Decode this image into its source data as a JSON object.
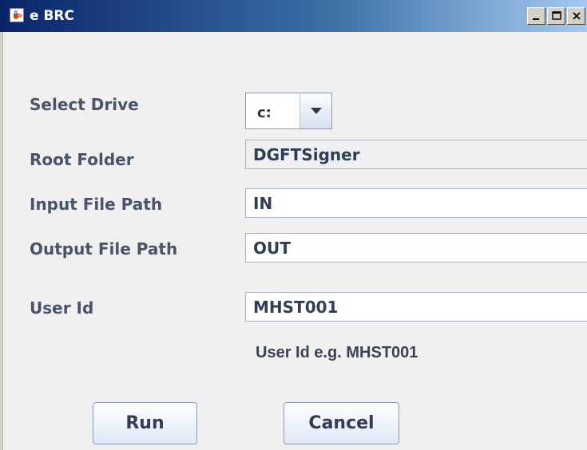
{
  "window": {
    "title": "e BRC",
    "controls": [
      "minimize",
      "maximize",
      "close"
    ]
  },
  "form": {
    "select_drive_label": "Select Drive",
    "select_drive_value": "c:",
    "root_folder_label": "Root Folder",
    "root_folder_value": "DGFTSigner",
    "input_file_path_label": "Input File Path",
    "input_file_path_value": "IN",
    "output_file_path_label": "Output File Path",
    "output_file_path_value": "OUT",
    "user_id_label": "User Id",
    "user_id_value": "MHST001",
    "user_id_hint": "User Id e.g. MHST001"
  },
  "buttons": {
    "run_label": "Run",
    "cancel_label": "Cancel"
  },
  "icons": {
    "app": "java-coffee-cup-icon",
    "dropdown": "chevron-down-icon",
    "minimize": "minimize-icon",
    "maximize": "maximize-icon",
    "close": "close-icon"
  },
  "colors": {
    "titlebar_start": "#0a246a",
    "titlebar_end": "#a6caf0",
    "label_text": "#4a5468",
    "field_text": "#2f3e54"
  }
}
